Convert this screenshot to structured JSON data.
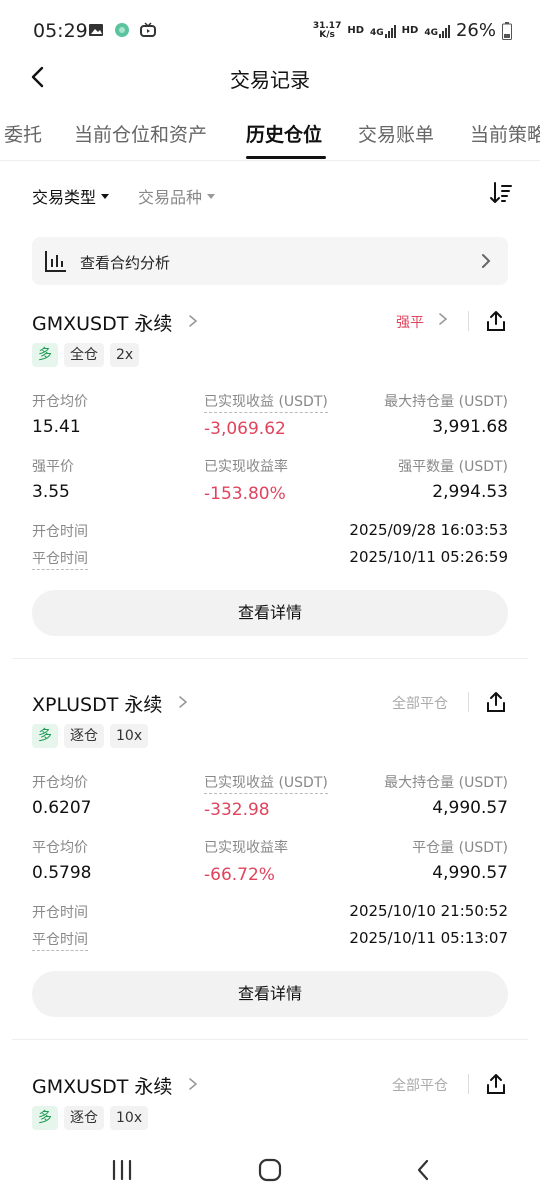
{
  "status_bar": {
    "time": "05:29",
    "speed_top": "31.17",
    "speed_bottom": "K/s",
    "hd1": "HD",
    "net1": "4G",
    "hd2": "HD",
    "net2": "4G",
    "battery": "26%"
  },
  "nav": {
    "title": "交易记录"
  },
  "tabs": [
    {
      "label": "委托"
    },
    {
      "label": "当前仓位和资产"
    },
    {
      "label": "历史仓位"
    },
    {
      "label": "交易账单"
    },
    {
      "label": "当前策略"
    }
  ],
  "filters": {
    "type_label": "交易类型",
    "product_label": "交易品种"
  },
  "analysis": {
    "label": "查看合约分析"
  },
  "cards": [
    {
      "symbol": "GMXUSDT 永续",
      "status": "强平",
      "badges": [
        "多",
        "全仓",
        "2x"
      ],
      "row1": {
        "l1": "开仓均价",
        "v1": "15.41",
        "l2": "已实现收益 (USDT)",
        "v2": "-3,069.62",
        "l3": "最大持仓量 (USDT)",
        "v3": "3,991.68"
      },
      "row2": {
        "l1": "强平价",
        "v1": "3.55",
        "l2": "已实现收益率",
        "v2": "-153.80%",
        "l3": "强平数量 (USDT)",
        "v3": "2,994.53"
      },
      "open_time_label": "开仓时间",
      "open_time": "2025/09/28 16:03:53",
      "close_time_label": "平仓时间",
      "close_time": "2025/10/11 05:26:59",
      "detail_label": "查看详情"
    },
    {
      "symbol": "XPLUSDT 永续",
      "status": "全部平仓",
      "badges": [
        "多",
        "逐仓",
        "10x"
      ],
      "row1": {
        "l1": "开仓均价",
        "v1": "0.6207",
        "l2": "已实现收益 (USDT)",
        "v2": "-332.98",
        "l3": "最大持仓量 (USDT)",
        "v3": "4,990.57"
      },
      "row2": {
        "l1": "平仓均价",
        "v1": "0.5798",
        "l2": "已实现收益率",
        "v2": "-66.72%",
        "l3": "平仓量 (USDT)",
        "v3": "4,990.57"
      },
      "open_time_label": "开仓时间",
      "open_time": "2025/10/10 21:50:52",
      "close_time_label": "平仓时间",
      "close_time": "2025/10/11 05:13:07",
      "detail_label": "查看详情"
    },
    {
      "symbol": "GMXUSDT 永续",
      "status": "全部平仓",
      "badges": [
        "多",
        "逐仓",
        "10x"
      ]
    }
  ],
  "colors": {
    "red": "#e0445d",
    "green": "#1e9a52",
    "badge_green_bg": "#e6f6ec"
  },
  "icons": [
    "back-icon",
    "sort-icon",
    "chart-icon",
    "chevron-right-icon",
    "share-icon",
    "recents-icon",
    "home-icon",
    "nav-back-icon"
  ]
}
